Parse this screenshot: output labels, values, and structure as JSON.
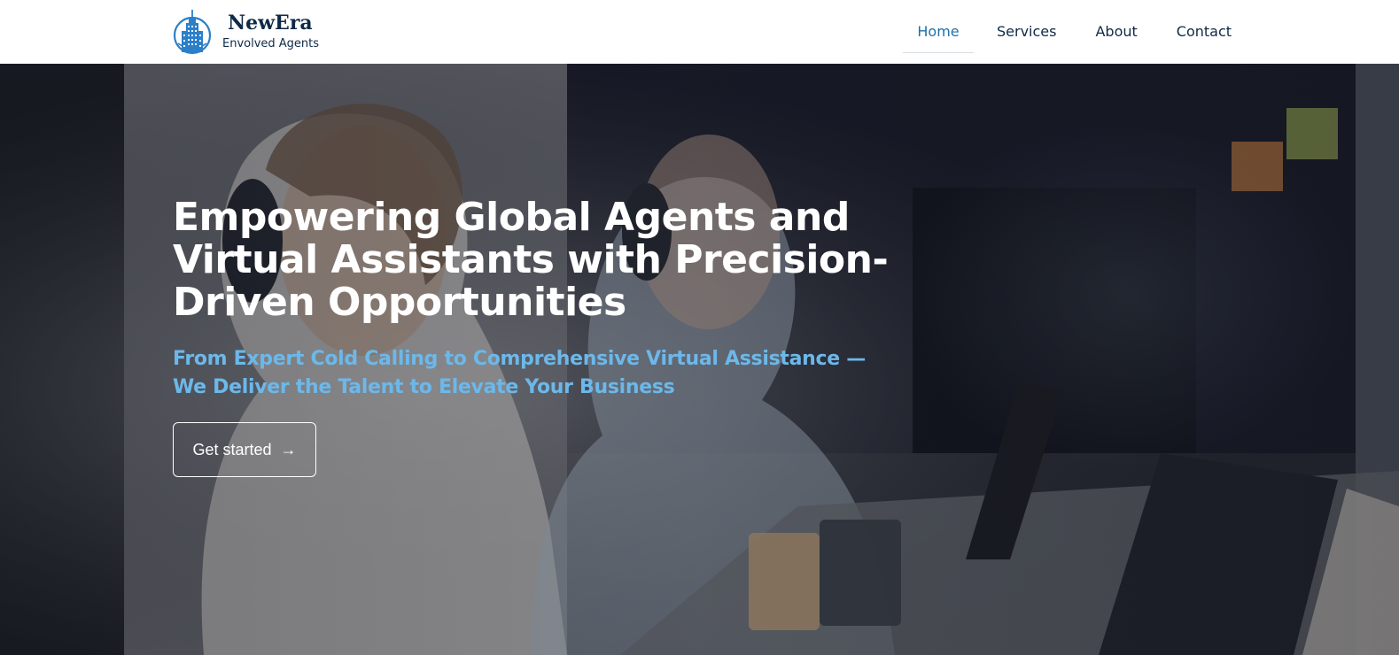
{
  "brand": {
    "name": "NewEra",
    "tagline": "Envolved Agents",
    "logo_icon": "skyscraper-globe-icon",
    "color": "#0e2a47",
    "logo_color": "#2c7fc9"
  },
  "nav": {
    "items": [
      {
        "label": "Home",
        "active": true
      },
      {
        "label": "Services",
        "active": false
      },
      {
        "label": "About",
        "active": false
      },
      {
        "label": "Contact",
        "active": false
      }
    ],
    "active_color": "#1f6fa8"
  },
  "hero": {
    "title": "Empowering Global Agents and Virtual Assistants with Precision-Driven Opportunities",
    "subtitle": "From Expert Cold Calling to Comprehensive Virtual Assistance — We Deliver the Talent to Elevate Your Business",
    "subtitle_color": "#6cb8ea",
    "cta_label": "Get started",
    "cta_icon": "arrow-right-icon",
    "background": "photo of call-center agents wearing headsets at laptops"
  }
}
